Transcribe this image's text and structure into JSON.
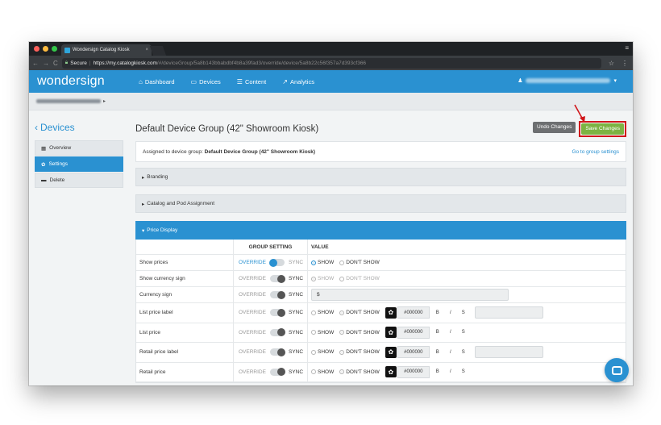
{
  "browser": {
    "tab_title": "Wondersign Catalog Kiosk",
    "tab_close": "×",
    "secure_label": "Secure",
    "url_scheme": "https://",
    "url_host": "my.catalogkiosk.com",
    "url_path": "/#/deviceGroup/5a8b143bbabdbf4b8a39fad3/override/device/5a8b22c56f357a7d393cf366",
    "nav_back": "←",
    "nav_forward": "→",
    "nav_reload": "C",
    "star": "☆",
    "kebab": "⋮",
    "window_menu": "≡"
  },
  "header": {
    "brand": "wondersign",
    "nav": [
      {
        "label": "Dashboard",
        "icon": "home-icon",
        "glyph": "⌂"
      },
      {
        "label": "Devices",
        "icon": "monitor-icon",
        "glyph": "▭"
      },
      {
        "label": "Content",
        "icon": "list-icon",
        "glyph": "☰"
      },
      {
        "label": "Analytics",
        "icon": "chart-icon",
        "glyph": "↗"
      }
    ],
    "user_icon": "♟",
    "user_caret": "▾"
  },
  "breadcrumb": {
    "chevron": "▸"
  },
  "sidebar": {
    "back_label": "Devices",
    "back_glyph": "‹",
    "items": [
      {
        "label": "Overview",
        "glyph": "▦"
      },
      {
        "label": "Settings",
        "glyph": "✿"
      },
      {
        "label": "Delete",
        "glyph": "▬"
      }
    ]
  },
  "page": {
    "title": "Default Device Group (42\" Showroom Kiosk)",
    "undo_label": "Undo Changes",
    "save_label": "Save Changes",
    "assigned_prefix": "Assigned to device group:",
    "assigned_group": "Default Device Group (42\" Showroom Kiosk)",
    "go_to_group": "Go to group settings",
    "sections": [
      {
        "label": "Branding",
        "glyph": "▸"
      },
      {
        "label": "Catalog and Pod Assignment",
        "glyph": "▸"
      },
      {
        "label": "Price Display",
        "glyph": "▾"
      }
    ]
  },
  "price_table": {
    "col_group": "GROUP SETTING",
    "col_value": "VALUE",
    "override": "OVERRIDE",
    "sync": "SYNC",
    "show": "SHOW",
    "dont_show": "DON'T SHOW",
    "bold": "B",
    "italic": "/",
    "strike": "S",
    "rows": [
      {
        "label": "Show prices",
        "color": ""
      },
      {
        "label": "Show currency sign",
        "color": ""
      },
      {
        "label": "Currency sign",
        "value": "$"
      },
      {
        "label": "List price label",
        "color": "#000000"
      },
      {
        "label": "List price",
        "color": "#000000"
      },
      {
        "label": "Retail price label",
        "color": "#000000"
      },
      {
        "label": "Retail price",
        "color": "#000000"
      }
    ]
  },
  "colors": {
    "primary": "#2a91d1",
    "save": "#7cb342",
    "highlight": "#d0161a"
  }
}
